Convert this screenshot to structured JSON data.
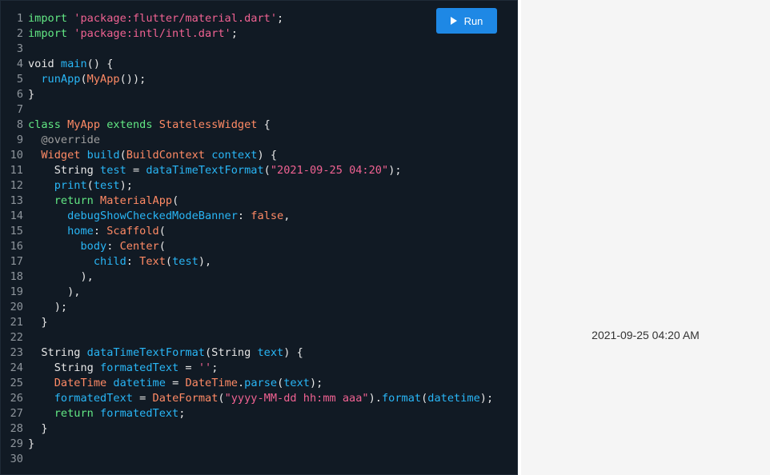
{
  "editor": {
    "run_button": {
      "label": "Run",
      "icon": "play-icon"
    },
    "colors": {
      "background": "#111a24",
      "default": "#e6e6e6",
      "keyword": "#62e884",
      "string": "#f06292",
      "type": "#ff8a65",
      "function": "#29b6f6",
      "annotation": "#9e9e9e",
      "line_number": "#8e959c"
    },
    "lines": [
      [
        [
          "import ",
          "keyword"
        ],
        [
          "'package:flutter/material.dart'",
          "string"
        ],
        [
          ";",
          "default"
        ]
      ],
      [
        [
          "import ",
          "keyword"
        ],
        [
          "'package:intl/intl.dart'",
          "string"
        ],
        [
          ";",
          "default"
        ]
      ],
      [],
      [
        [
          "void ",
          "default"
        ],
        [
          "main",
          "function"
        ],
        [
          "() {",
          "default"
        ]
      ],
      [
        [
          "  ",
          "default"
        ],
        [
          "runApp",
          "function"
        ],
        [
          "(",
          "default"
        ],
        [
          "MyApp",
          "type"
        ],
        [
          "());",
          "default"
        ]
      ],
      [
        [
          "}",
          "default"
        ]
      ],
      [],
      [
        [
          "class ",
          "keyword"
        ],
        [
          "MyApp ",
          "type"
        ],
        [
          "extends ",
          "keyword"
        ],
        [
          "StatelessWidget",
          "type"
        ],
        [
          " {",
          "default"
        ]
      ],
      [
        [
          "  @override",
          "annotation"
        ]
      ],
      [
        [
          "  ",
          "default"
        ],
        [
          "Widget ",
          "type"
        ],
        [
          "build",
          "function"
        ],
        [
          "(",
          "default"
        ],
        [
          "BuildContext ",
          "type"
        ],
        [
          "context",
          "function"
        ],
        [
          ") {",
          "default"
        ]
      ],
      [
        [
          "    String ",
          "default"
        ],
        [
          "test",
          "function"
        ],
        [
          " = ",
          "default"
        ],
        [
          "dataTimeTextFormat",
          "function"
        ],
        [
          "(",
          "default"
        ],
        [
          "\"2021-09-25 04:20\"",
          "string"
        ],
        [
          ");",
          "default"
        ]
      ],
      [
        [
          "    ",
          "default"
        ],
        [
          "print",
          "function"
        ],
        [
          "(",
          "default"
        ],
        [
          "test",
          "function"
        ],
        [
          ");",
          "default"
        ]
      ],
      [
        [
          "    return ",
          "keyword"
        ],
        [
          "MaterialApp",
          "type"
        ],
        [
          "(",
          "default"
        ]
      ],
      [
        [
          "      ",
          "default"
        ],
        [
          "debugShowCheckedModeBanner",
          "function"
        ],
        [
          ": ",
          "default"
        ],
        [
          "false",
          "type"
        ],
        [
          ",",
          "default"
        ]
      ],
      [
        [
          "      ",
          "default"
        ],
        [
          "home",
          "function"
        ],
        [
          ": ",
          "default"
        ],
        [
          "Scaffold",
          "type"
        ],
        [
          "(",
          "default"
        ]
      ],
      [
        [
          "        ",
          "default"
        ],
        [
          "body",
          "function"
        ],
        [
          ": ",
          "default"
        ],
        [
          "Center",
          "type"
        ],
        [
          "(",
          "default"
        ]
      ],
      [
        [
          "          ",
          "default"
        ],
        [
          "child",
          "function"
        ],
        [
          ": ",
          "default"
        ],
        [
          "Text",
          "type"
        ],
        [
          "(",
          "default"
        ],
        [
          "test",
          "function"
        ],
        [
          "),",
          "default"
        ]
      ],
      [
        [
          "        ),",
          "default"
        ]
      ],
      [
        [
          "      ),",
          "default"
        ]
      ],
      [
        [
          "    );",
          "default"
        ]
      ],
      [
        [
          "  }",
          "default"
        ]
      ],
      [],
      [
        [
          "  String ",
          "default"
        ],
        [
          "dataTimeTextFormat",
          "function"
        ],
        [
          "(String ",
          "default"
        ],
        [
          "text",
          "function"
        ],
        [
          ") {",
          "default"
        ]
      ],
      [
        [
          "    String ",
          "default"
        ],
        [
          "formatedText",
          "function"
        ],
        [
          " = ",
          "default"
        ],
        [
          "''",
          "string"
        ],
        [
          ";",
          "default"
        ]
      ],
      [
        [
          "    ",
          "default"
        ],
        [
          "DateTime ",
          "type"
        ],
        [
          "datetime",
          "function"
        ],
        [
          " = ",
          "default"
        ],
        [
          "DateTime",
          "type"
        ],
        [
          ".",
          "default"
        ],
        [
          "parse",
          "function"
        ],
        [
          "(",
          "default"
        ],
        [
          "text",
          "function"
        ],
        [
          ");",
          "default"
        ]
      ],
      [
        [
          "    ",
          "default"
        ],
        [
          "formatedText",
          "function"
        ],
        [
          " = ",
          "default"
        ],
        [
          "DateFormat",
          "type"
        ],
        [
          "(",
          "default"
        ],
        [
          "\"yyyy-MM-dd hh:mm aaa\"",
          "string"
        ],
        [
          ").",
          "default"
        ],
        [
          "format",
          "function"
        ],
        [
          "(",
          "default"
        ],
        [
          "datetime",
          "function"
        ],
        [
          ");",
          "default"
        ]
      ],
      [
        [
          "    return ",
          "keyword"
        ],
        [
          "formatedText",
          "function"
        ],
        [
          ";",
          "default"
        ]
      ],
      [
        [
          "  }",
          "default"
        ]
      ],
      [
        [
          "}",
          "default"
        ]
      ],
      []
    ]
  },
  "preview": {
    "output_text": "2021-09-25 04:20 AM"
  }
}
